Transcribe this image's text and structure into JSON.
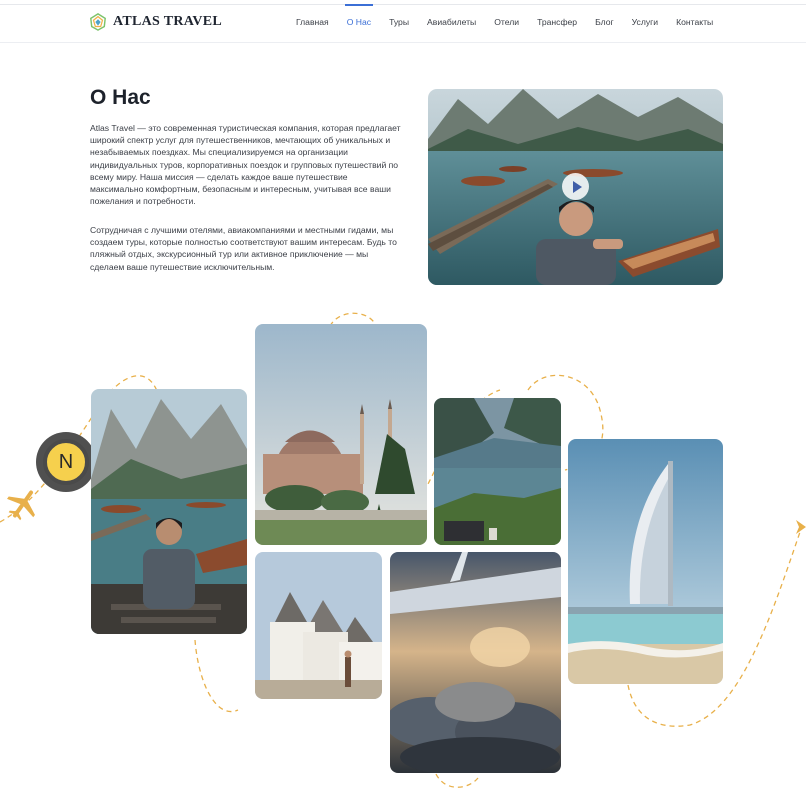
{
  "header": {
    "brand": "ATLAS TRAVEL",
    "nav": [
      {
        "label": "Главная",
        "active": false
      },
      {
        "label": "О Нас",
        "active": true
      },
      {
        "label": "Туры",
        "active": false
      },
      {
        "label": "Авиабилеты",
        "active": false
      },
      {
        "label": "Отели",
        "active": false
      },
      {
        "label": "Трансфер",
        "active": false
      },
      {
        "label": "Блог",
        "active": false
      },
      {
        "label": "Услуги",
        "active": false
      },
      {
        "label": "Контакты",
        "active": false
      }
    ]
  },
  "about": {
    "title": "О Нас",
    "paragraph1": "Atlas Travel — это современная туристическая компания, которая предлагает широкий спектр услуг для путешественников, мечтающих об уникальных и незабываемых поездках. Мы специализируемся на организации индивидуальных туров, корпоративных поездок и групповых путешествий по всему миру. Наша миссия — сделать каждое ваше путешествие максимально комфортным, безопасным и интересным, учитывая все ваши пожелания и потребности.",
    "paragraph2": "Сотрудничая с лучшими отелями, авиакомпаниями и местными гидами, мы создаем туры, которые полностью соответствуют вашим интересам. Будь то пляжный отдых, экскурсионный тур или активное приключение — мы сделаем ваше путешествие исключительным."
  },
  "badge": {
    "letter": "N"
  },
  "colors": {
    "accent": "#3b6fd6",
    "route": "#e8b04a",
    "badge": "#f6d04d"
  },
  "icons": [
    "logo-icon",
    "play-icon",
    "plane-icon"
  ]
}
